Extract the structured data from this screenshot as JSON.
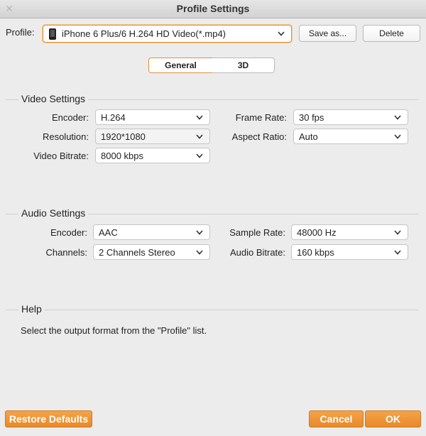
{
  "window": {
    "title": "Profile Settings"
  },
  "profile": {
    "label": "Profile:",
    "value": "iPhone 6 Plus/6 H.264 HD Video(*.mp4)",
    "save_label": "Save as...",
    "delete_label": "Delete"
  },
  "tabs": [
    {
      "label": "General",
      "active": true
    },
    {
      "label": "3D",
      "active": false
    }
  ],
  "video": {
    "title": "Video Settings",
    "encoder": {
      "label": "Encoder:",
      "value": "H.264"
    },
    "resolution": {
      "label": "Resolution:",
      "value": "1920*1080"
    },
    "bitrate": {
      "label": "Video Bitrate:",
      "value": "8000 kbps"
    },
    "frame_rate": {
      "label": "Frame Rate:",
      "value": "30 fps"
    },
    "aspect_ratio": {
      "label": "Aspect Ratio:",
      "value": "Auto"
    }
  },
  "audio": {
    "title": "Audio Settings",
    "encoder": {
      "label": "Encoder:",
      "value": "AAC"
    },
    "channels": {
      "label": "Channels:",
      "value": "2 Channels Stereo"
    },
    "sample_rate": {
      "label": "Sample Rate:",
      "value": "48000 Hz"
    },
    "bitrate": {
      "label": "Audio Bitrate:",
      "value": "160 kbps"
    }
  },
  "help": {
    "title": "Help",
    "text": "Select the output format from the \"Profile\" list."
  },
  "footer": {
    "restore_label": "Restore Defaults",
    "cancel_label": "Cancel",
    "ok_label": "OK"
  },
  "colors": {
    "accent": "#e8892a",
    "focus_border": "#e0913a"
  },
  "icons": {
    "close": "close-icon",
    "device": "phone-icon",
    "dropdown": "chevron-down-icon"
  }
}
